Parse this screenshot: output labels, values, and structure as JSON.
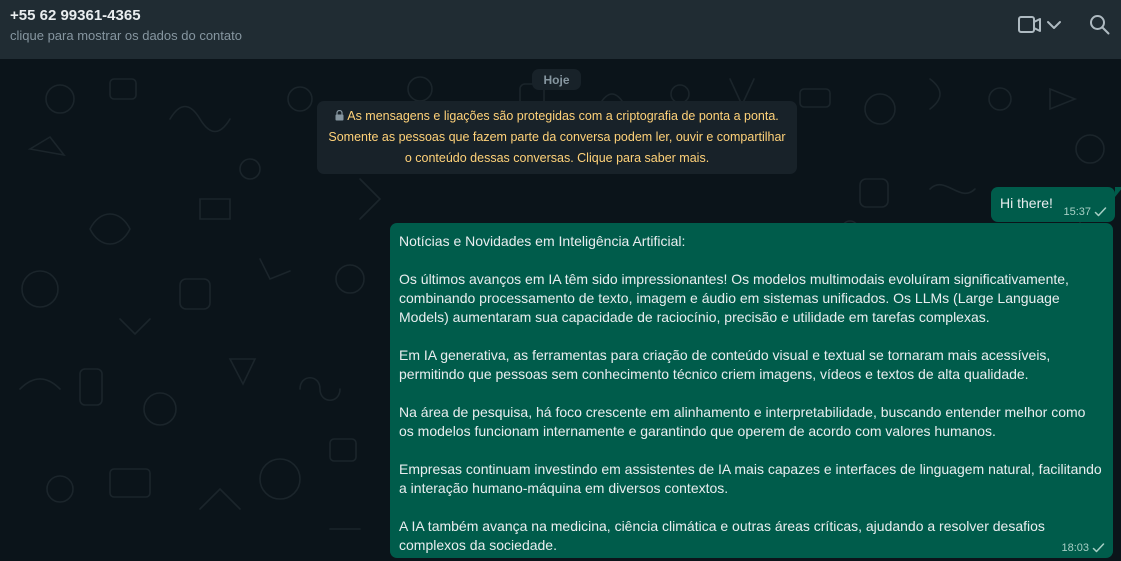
{
  "header": {
    "contact_name": "+55 62 99361-4365",
    "contact_subtitle": "clique para mostrar os dados do contato",
    "icons": [
      "video-call-icon",
      "chevron-down-icon",
      "search-icon"
    ]
  },
  "chat": {
    "date_label": "Hoje",
    "encryption_notice": {
      "line1": "As mensagens e ligações são protegidas com a criptografia de ponta a ponta.",
      "line2": "Somente as pessoas que fazem parte da conversa podem ler, ouvir e compartilhar",
      "line3": "o conteúdo dessas conversas. Clique para saber mais."
    },
    "messages": [
      {
        "direction": "outgoing",
        "text": "Hi there!",
        "time": "15:37",
        "status": "sent"
      },
      {
        "direction": "outgoing",
        "paragraphs": [
          "Notícias e Novidades em Inteligência Artificial:",
          "Os últimos avanços em IA têm sido impressionantes! Os modelos multimodais evoluíram significativamente, combinando processamento de texto, imagem e áudio em sistemas unificados. Os LLMs (Large Language Models) aumentaram sua capacidade de raciocínio, precisão e utilidade em tarefas complexas.",
          "Em IA generativa, as ferramentas para criação de conteúdo visual e textual se tornaram mais acessíveis, permitindo que pessoas sem conhecimento técnico criem imagens, vídeos e textos de alta qualidade.",
          "Na área de pesquisa, há foco crescente em alinhamento e interpretabilidade, buscando entender melhor como os modelos funcionam internamente e garantindo que operem de acordo com valores humanos.",
          "Empresas continuam investindo em assistentes de IA mais capazes e interfaces de linguagem natural, facilitando a interação humano-máquina em diversos contextos.",
          "A IA também avança na medicina, ciência climática e outras áreas críticas, ajudando a resolver desafios complexos da sociedade."
        ],
        "time": "18:03",
        "status": "sent"
      }
    ]
  },
  "colors": {
    "header_bg": "#202c33",
    "chat_bg": "#0b141a",
    "outgoing_bubble": "#005c4b",
    "system_bubble": "#182229",
    "encryption_text": "#ffd279",
    "muted_text": "#8696a0"
  }
}
